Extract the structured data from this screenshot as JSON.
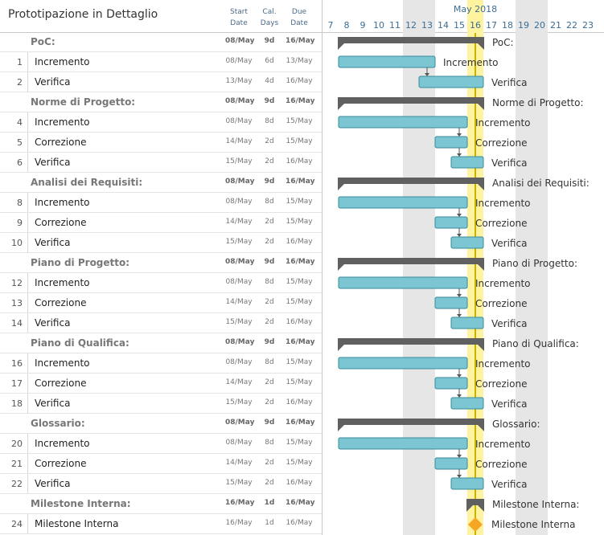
{
  "title": "Prototipazione in Dettaglio",
  "columns": {
    "start": [
      "Start",
      "Date"
    ],
    "days": [
      "Cal.",
      "Days"
    ],
    "due": [
      "Due",
      "Date"
    ]
  },
  "colors": {
    "task_bar": "#7cc6d4",
    "task_bar_stroke": "#3a8a9a",
    "summary_bar": "#606060",
    "weekend": "#e6e6e6",
    "today": "#fff3a0",
    "today_line": "#c8b400",
    "milestone": "#f5a623",
    "month_label": "#3a6d96"
  },
  "rows": [
    {
      "id": "g0",
      "num": "",
      "name": "PoC:",
      "group": true,
      "start": "08/May",
      "days": "9d",
      "due": "16/May"
    },
    {
      "id": "t1",
      "num": "1",
      "name": "Incremento",
      "start": "08/May",
      "days": "6d",
      "due": "13/May"
    },
    {
      "id": "t2",
      "num": "2",
      "name": "Verifica",
      "start": "13/May",
      "days": "4d",
      "due": "16/May"
    },
    {
      "id": "g3",
      "num": "",
      "name": "Norme di Progetto:",
      "group": true,
      "start": "08/May",
      "days": "9d",
      "due": "16/May"
    },
    {
      "id": "t4",
      "num": "4",
      "name": "Incremento",
      "start": "08/May",
      "days": "8d",
      "due": "15/May"
    },
    {
      "id": "t5",
      "num": "5",
      "name": "Correzione",
      "start": "14/May",
      "days": "2d",
      "due": "15/May"
    },
    {
      "id": "t6",
      "num": "6",
      "name": "Verifica",
      "start": "15/May",
      "days": "2d",
      "due": "16/May"
    },
    {
      "id": "g7",
      "num": "",
      "name": "Analisi dei Requisiti:",
      "group": true,
      "start": "08/May",
      "days": "9d",
      "due": "16/May"
    },
    {
      "id": "t8",
      "num": "8",
      "name": "Incremento",
      "start": "08/May",
      "days": "8d",
      "due": "15/May"
    },
    {
      "id": "t9",
      "num": "9",
      "name": "Correzione",
      "start": "14/May",
      "days": "2d",
      "due": "15/May"
    },
    {
      "id": "t10",
      "num": "10",
      "name": "Verifica",
      "start": "15/May",
      "days": "2d",
      "due": "16/May"
    },
    {
      "id": "g11",
      "num": "",
      "name": "Piano di Progetto:",
      "group": true,
      "start": "08/May",
      "days": "9d",
      "due": "16/May"
    },
    {
      "id": "t12",
      "num": "12",
      "name": "Incremento",
      "start": "08/May",
      "days": "8d",
      "due": "15/May"
    },
    {
      "id": "t13",
      "num": "13",
      "name": "Correzione",
      "start": "14/May",
      "days": "2d",
      "due": "15/May"
    },
    {
      "id": "t14",
      "num": "14",
      "name": "Verifica",
      "start": "15/May",
      "days": "2d",
      "due": "16/May"
    },
    {
      "id": "g15",
      "num": "",
      "name": "Piano di Qualifica:",
      "group": true,
      "start": "08/May",
      "days": "9d",
      "due": "16/May"
    },
    {
      "id": "t16",
      "num": "16",
      "name": "Incremento",
      "start": "08/May",
      "days": "8d",
      "due": "15/May"
    },
    {
      "id": "t17",
      "num": "17",
      "name": "Correzione",
      "start": "14/May",
      "days": "2d",
      "due": "15/May"
    },
    {
      "id": "t18",
      "num": "18",
      "name": "Verifica",
      "start": "15/May",
      "days": "2d",
      "due": "16/May"
    },
    {
      "id": "g19",
      "num": "",
      "name": "Glossario:",
      "group": true,
      "start": "08/May",
      "days": "9d",
      "due": "16/May"
    },
    {
      "id": "t20",
      "num": "20",
      "name": "Incremento",
      "start": "08/May",
      "days": "8d",
      "due": "15/May"
    },
    {
      "id": "t21",
      "num": "21",
      "name": "Correzione",
      "start": "14/May",
      "days": "2d",
      "due": "15/May"
    },
    {
      "id": "t22",
      "num": "22",
      "name": "Verifica",
      "start": "15/May",
      "days": "2d",
      "due": "16/May"
    },
    {
      "id": "g23",
      "num": "",
      "name": "Milestone Interna:",
      "group": true,
      "start": "16/May",
      "days": "1d",
      "due": "16/May"
    },
    {
      "id": "t24",
      "num": "24",
      "name": "Milestone Interna",
      "start": "16/May",
      "days": "1d",
      "due": "16/May",
      "milestone": true
    }
  ],
  "chart_data": {
    "type": "gantt",
    "month_label": "May 2018",
    "days": [
      "7",
      "8",
      "9",
      "10",
      "11",
      "12",
      "13",
      "14",
      "15",
      "16",
      "17",
      "18",
      "19",
      "20",
      "21",
      "22",
      "23"
    ],
    "weekend_days": [
      12,
      13,
      19,
      20
    ],
    "today": 16,
    "tasks": [
      {
        "row": 0,
        "label": "PoC:",
        "start": 8,
        "end": 16,
        "kind": "summary"
      },
      {
        "row": 1,
        "label": "Incremento",
        "start": 8,
        "end": 13,
        "kind": "task"
      },
      {
        "row": 2,
        "label": "Verifica",
        "start": 13,
        "end": 16,
        "kind": "task"
      },
      {
        "row": 3,
        "label": "Norme di Progetto:",
        "start": 8,
        "end": 16,
        "kind": "summary"
      },
      {
        "row": 4,
        "label": "Incremento",
        "start": 8,
        "end": 15,
        "kind": "task"
      },
      {
        "row": 5,
        "label": "Correzione",
        "start": 14,
        "end": 15,
        "kind": "task"
      },
      {
        "row": 6,
        "label": "Verifica",
        "start": 15,
        "end": 16,
        "kind": "task"
      },
      {
        "row": 7,
        "label": "Analisi dei Requisiti:",
        "start": 8,
        "end": 16,
        "kind": "summary"
      },
      {
        "row": 8,
        "label": "Incremento",
        "start": 8,
        "end": 15,
        "kind": "task"
      },
      {
        "row": 9,
        "label": "Correzione",
        "start": 14,
        "end": 15,
        "kind": "task"
      },
      {
        "row": 10,
        "label": "Verifica",
        "start": 15,
        "end": 16,
        "kind": "task"
      },
      {
        "row": 11,
        "label": "Piano di Progetto:",
        "start": 8,
        "end": 16,
        "kind": "summary"
      },
      {
        "row": 12,
        "label": "Incremento",
        "start": 8,
        "end": 15,
        "kind": "task"
      },
      {
        "row": 13,
        "label": "Correzione",
        "start": 14,
        "end": 15,
        "kind": "task"
      },
      {
        "row": 14,
        "label": "Verifica",
        "start": 15,
        "end": 16,
        "kind": "task"
      },
      {
        "row": 15,
        "label": "Piano di Qualifica:",
        "start": 8,
        "end": 16,
        "kind": "summary"
      },
      {
        "row": 16,
        "label": "Incremento",
        "start": 8,
        "end": 15,
        "kind": "task"
      },
      {
        "row": 17,
        "label": "Correzione",
        "start": 14,
        "end": 15,
        "kind": "task"
      },
      {
        "row": 18,
        "label": "Verifica",
        "start": 15,
        "end": 16,
        "kind": "task"
      },
      {
        "row": 19,
        "label": "Glossario:",
        "start": 8,
        "end": 16,
        "kind": "summary"
      },
      {
        "row": 20,
        "label": "Incremento",
        "start": 8,
        "end": 15,
        "kind": "task"
      },
      {
        "row": 21,
        "label": "Correzione",
        "start": 14,
        "end": 15,
        "kind": "task"
      },
      {
        "row": 22,
        "label": "Verifica",
        "start": 15,
        "end": 16,
        "kind": "task"
      },
      {
        "row": 23,
        "label": "Milestone Interna:",
        "start": 16,
        "end": 16,
        "kind": "summary"
      },
      {
        "row": 24,
        "label": "Milestone Interna",
        "start": 16,
        "end": 16,
        "kind": "milestone"
      }
    ],
    "dependencies": [
      [
        1,
        2
      ],
      [
        4,
        5
      ],
      [
        5,
        6
      ],
      [
        8,
        9
      ],
      [
        9,
        10
      ],
      [
        12,
        13
      ],
      [
        13,
        14
      ],
      [
        16,
        17
      ],
      [
        17,
        18
      ],
      [
        20,
        21
      ],
      [
        21,
        22
      ]
    ]
  }
}
